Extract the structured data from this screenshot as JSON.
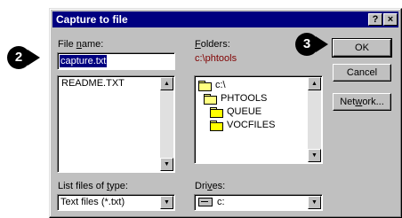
{
  "dialog": {
    "title": "Capture to file",
    "help_glyph": "?",
    "close_glyph": "×"
  },
  "callouts": {
    "two": "2",
    "three": "3"
  },
  "filename": {
    "label_pre": "File ",
    "label_key": "n",
    "label_post": "ame:",
    "value": "capture.txt"
  },
  "file_list": {
    "items": [
      "README.TXT"
    ]
  },
  "folders": {
    "label_key": "F",
    "label_post": "olders:",
    "path": "c:\\phtools",
    "tree": [
      "c:\\",
      "PHTOOLS",
      "QUEUE",
      "VOCFILES"
    ]
  },
  "buttons": {
    "ok": "OK",
    "cancel": "Cancel",
    "network_pre": "Net",
    "network_key": "w",
    "network_post": "ork..."
  },
  "file_type": {
    "label_pre": "List files of ",
    "label_key": "t",
    "label_post": "ype:",
    "value": "Text files (*.txt)"
  },
  "drives": {
    "label_pre": "Dri",
    "label_key": "v",
    "label_post": "es:",
    "value": "c:"
  },
  "colors": {
    "title_bar": "#000080",
    "path_text": "#800000",
    "selection": "#000080"
  }
}
